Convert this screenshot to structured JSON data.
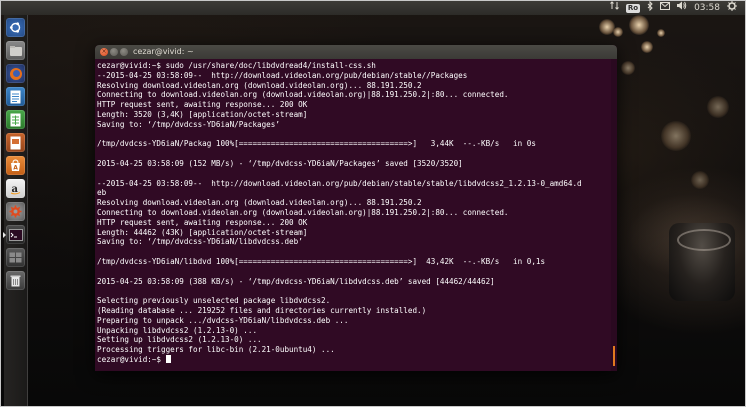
{
  "panel": {
    "keyboard_layout": "Ro",
    "clock": "03:58",
    "icons": [
      "arrows-updown-icon",
      "keyboard-layout-icon",
      "bluetooth-icon",
      "mail-icon",
      "volume-icon",
      "clock-text",
      "power-gear-icon"
    ]
  },
  "launcher": {
    "items": [
      "ubuntu-dash-icon",
      "files-icon",
      "firefox-icon",
      "writer-icon",
      "calc-icon",
      "impress-icon",
      "software-center-icon",
      "amazon-icon",
      "settings-icon",
      "terminal-icon",
      "workspace-switcher-icon",
      "trash-icon"
    ]
  },
  "terminal": {
    "title": "cezar@vivid: ~",
    "lines": [
      "cezar@vivid:~$ sudo /usr/share/doc/libdvdread4/install-css.sh",
      "--2015-04-25 03:58:09--  http://download.videolan.org/pub/debian/stable//Packages",
      "Resolving download.videolan.org (download.videolan.org)... 88.191.250.2",
      "Connecting to download.videolan.org (download.videolan.org)|88.191.250.2|:80... connected.",
      "HTTP request sent, awaiting response... 200 OK",
      "Length: 3520 (3,4K) [application/octet-stream]",
      "Saving to: ‘/tmp/dvdcss-YD6iaN/Packages’",
      "",
      "/tmp/dvdcss-YD6iaN/Packag 100%[=====================================>]   3,44K  --.-KB/s   in 0s",
      "",
      "2015-04-25 03:58:09 (152 MB/s) - ‘/tmp/dvdcss-YD6iaN/Packages’ saved [3520/3520]",
      "",
      "--2015-04-25 03:58:09--  http://download.videolan.org/pub/debian/stable/stable/libdvdcss2_1.2.13-0_amd64.d",
      "eb",
      "Resolving download.videolan.org (download.videolan.org)... 88.191.250.2",
      "Connecting to download.videolan.org (download.videolan.org)|88.191.250.2|:80... connected.",
      "HTTP request sent, awaiting response... 200 OK",
      "Length: 44462 (43K) [application/octet-stream]",
      "Saving to: ‘/tmp/dvdcss-YD6iaN/libdvdcss.deb’",
      "",
      "/tmp/dvdcss-YD6iaN/libdvd 100%[=====================================>]  43,42K  --.-KB/s   in 0,1s",
      "",
      "2015-04-25 03:58:09 (388 KB/s) - ‘/tmp/dvdcss-YD6iaN/libdvdcss.deb’ saved [44462/44462]",
      "",
      "Selecting previously unselected package libdvdcss2.",
      "(Reading database ... 219252 files and directories currently installed.)",
      "Preparing to unpack .../dvdcss-YD6iaN/libdvdcss.deb ...",
      "Unpacking libdvdcss2 (1.2.13-0) ...",
      "Setting up libdvdcss2 (1.2.13-0) ...",
      "Processing triggers for libc-bin (2.21-0ubuntu4) ..."
    ],
    "prompt": "cezar@vivid:~$ "
  }
}
